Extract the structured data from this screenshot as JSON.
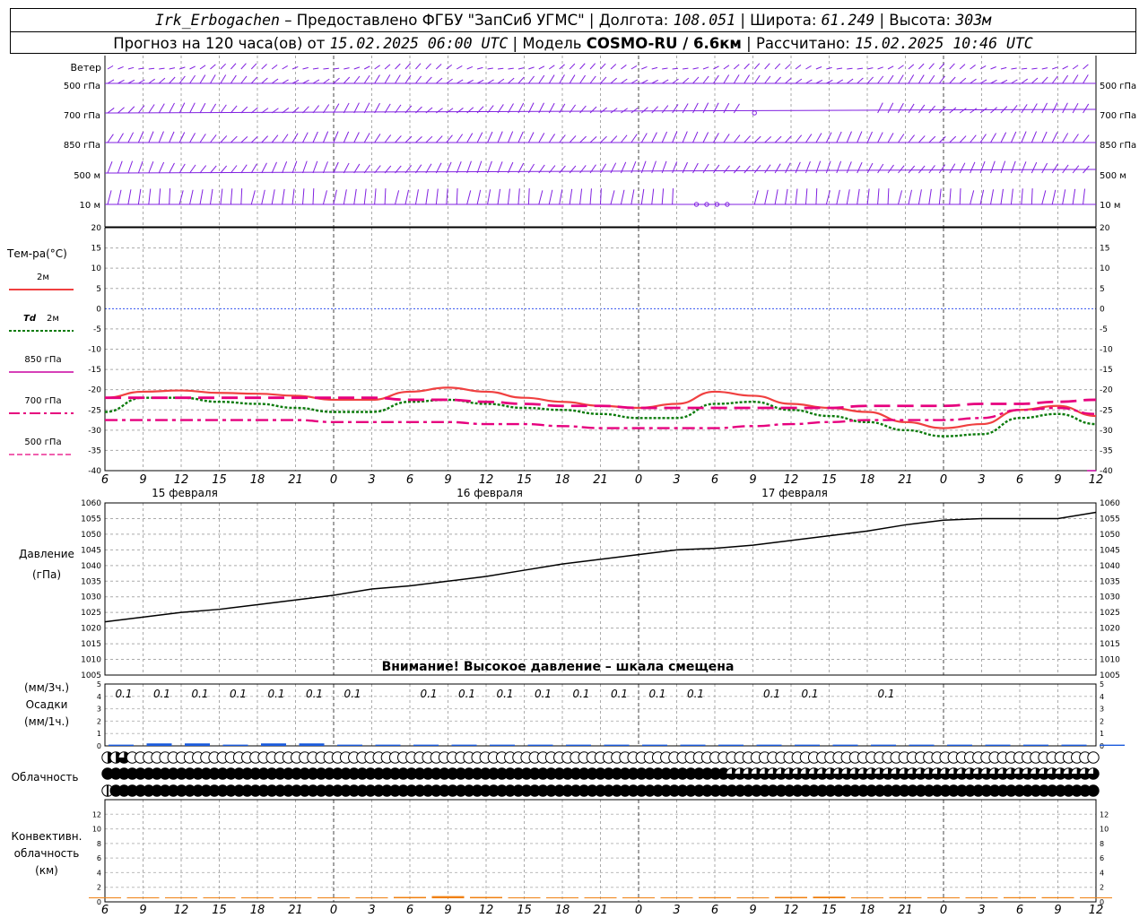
{
  "header": {
    "station": "Irk_Erbogachen",
    "provider": " – Предоставлено ФГБУ \"ЗапСиб УГМС\" | Долгота: ",
    "lon": "108.051",
    "lat_label": " | Широта: ",
    "lat": "61.249",
    "alt_label": " | Высота: ",
    "alt": "303м",
    "forecast_label": "Прогноз на 120 часа(ов) от ",
    "forecast_time": "15.02.2025 06:00 UTC",
    "model_label": "  | Модель ",
    "model": "COSMO-RU / 6.6км",
    "calc_label": " | Рассчитано: ",
    "calc_time": "15.02.2025 10:46 UTC"
  },
  "labels": {
    "wind": "Ветер",
    "levels": [
      "500 гПа",
      "700 гПа",
      "850 гПа",
      "500 м",
      "10  м"
    ],
    "temp_title": "Тем-ра(°C)",
    "t2m": "2м",
    "td_a": "Td",
    "td_b": "2м",
    "t850": "850 гПа",
    "t700": "700 гПа",
    "t500": "500 гПа",
    "pressure_a": "Давление",
    "pressure_b": "(гПа)",
    "warning": "Внимание! Высокое давление – шкала смещена",
    "precip_a": "(мм/3ч.)",
    "precip_b": "Осадки",
    "precip_c": "(мм/1ч.)",
    "cloud": "Облачность",
    "conv_a": "Конвективн.",
    "conv_b": "облачность",
    "conv_c": "(км)",
    "days": [
      "15 февраля",
      "16 февраля",
      "17 февраля"
    ],
    "precip_amount": "0.1"
  },
  "colors": {
    "t2m": "#f04040",
    "td": "#0a7a0a",
    "t850": "#c800a0",
    "t700": "#e6007e",
    "t500": "#e6007e",
    "wind": "#8020e0",
    "precip": "#1a5adc",
    "conv": "#f08010",
    "zero": "#3050f0"
  },
  "chart_data": [
    {
      "type": "line",
      "title": "Тем-ра(°C)",
      "x_ticks": [
        "6",
        "9",
        "12",
        "15",
        "18",
        "21",
        "0",
        "3",
        "6",
        "9",
        "12",
        "15",
        "18",
        "21",
        "0",
        "3",
        "6",
        "9",
        "12",
        "15",
        "18",
        "21",
        "0",
        "3",
        "6",
        "9",
        "12"
      ],
      "ylim": [
        -40,
        20
      ],
      "y_ticks": [
        20,
        15,
        10,
        5,
        0,
        -5,
        -10,
        -15,
        -20,
        -25,
        -30,
        -35,
        -40
      ],
      "series": [
        {
          "name": "2м",
          "style": "solid",
          "values": [
            -22,
            -20.5,
            -20.2,
            -20.8,
            -21,
            -21.5,
            -22.5,
            -22.5,
            -20.5,
            -19.5,
            -20.5,
            -22,
            -23,
            -24,
            -24.5,
            -23.5,
            -20.5,
            -21.5,
            -23.5,
            -24.5,
            -25.5,
            -28,
            -29.5,
            -28.5,
            -25,
            -24,
            -26.5
          ]
        },
        {
          "name": "Td 2м",
          "style": "dotted",
          "values": [
            -25.5,
            -22,
            -22,
            -23,
            -23.5,
            -24.5,
            -25.5,
            -25.5,
            -23,
            -22.5,
            -23.5,
            -24.5,
            -25,
            -26,
            -27,
            -27,
            -23.5,
            -23,
            -25,
            -26.5,
            -28,
            -30,
            -31.5,
            -31,
            -27,
            -26,
            -28.5
          ]
        },
        {
          "name": "850 гПа",
          "style": "solid",
          "values": [
            null,
            null,
            null,
            null,
            null,
            null,
            null,
            null,
            null,
            null,
            null,
            null,
            null,
            null,
            null,
            null,
            null,
            null,
            null,
            null,
            null,
            null,
            null,
            null,
            null,
            null,
            -40
          ]
        },
        {
          "name": "700 гПа",
          "style": "dashdot",
          "values": [
            -27.5,
            -27.5,
            -27.5,
            -27.5,
            -27.5,
            -27.5,
            -28,
            -28,
            -28,
            -28,
            -28.5,
            -28.5,
            -29,
            -29.5,
            -29.5,
            -29.5,
            -29.5,
            -29,
            -28.5,
            -28,
            -27.5,
            -27.5,
            -27.5,
            -27,
            -25,
            -24.5,
            -26
          ]
        },
        {
          "name": "500 гПа",
          "style": "dashed",
          "values": [
            -22,
            -22,
            -22,
            -22,
            -22,
            -22,
            -22,
            -22,
            -22.5,
            -22.5,
            -23,
            -23.5,
            -24,
            -24,
            -24.5,
            -24.5,
            -24.5,
            -24.5,
            -24.5,
            -24.5,
            -24,
            -24,
            -24,
            -23.5,
            -23.5,
            -23,
            -22.5
          ]
        }
      ]
    },
    {
      "type": "line",
      "title": "Давление (гПа)",
      "ylim": [
        1005,
        1060
      ],
      "y_ticks": [
        1060,
        1055,
        1050,
        1045,
        1040,
        1035,
        1030,
        1025,
        1020,
        1015,
        1010,
        1005
      ],
      "series": [
        {
          "name": "Давление",
          "values": [
            1022,
            1023.5,
            1025,
            1026,
            1027.5,
            1029,
            1030.5,
            1032.5,
            1033.5,
            1035,
            1036.5,
            1038.5,
            1040.5,
            1042,
            1043.5,
            1045,
            1045.5,
            1046.5,
            1048,
            1049.5,
            1051,
            1053,
            1054.5,
            1055,
            1055,
            1055,
            1057
          ]
        }
      ]
    },
    {
      "type": "bar",
      "title": "Осадки (мм/3ч.)",
      "ylim": [
        0,
        5
      ],
      "y_ticks": [
        5,
        4,
        3,
        2,
        1,
        0
      ],
      "values": [
        0.1,
        0.1,
        0.1,
        0.1,
        0.1,
        0.1,
        0.1,
        null,
        0.1,
        0.1,
        0.1,
        0.1,
        0.1,
        0.1,
        0.1,
        0.1,
        null,
        0.1,
        0.1,
        null,
        0.1,
        null,
        null,
        null,
        null,
        null,
        null
      ],
      "hourly_bars": [
        0.05,
        0.1,
        0.1,
        0.05,
        0.1,
        0.1,
        0.05,
        0.05,
        0.05,
        0.05,
        0.05,
        0.05,
        0.05,
        0.05,
        0.05,
        0.05,
        0.05,
        0.05,
        0.05,
        0.05,
        0.05,
        0.05,
        0.05,
        0.05,
        0.05,
        0.05,
        0.05
      ]
    },
    {
      "type": "table",
      "title": "Облачность",
      "rows": [
        [
          2,
          2,
          3,
          0,
          0,
          0,
          0,
          0,
          0,
          0,
          0,
          0,
          0,
          0,
          0,
          0,
          0,
          0,
          0,
          0,
          0,
          0,
          0,
          0,
          0,
          0,
          0,
          0,
          0,
          0,
          0,
          0,
          0,
          0,
          0,
          0,
          0,
          0,
          0,
          0,
          0,
          0,
          0,
          0,
          0,
          0,
          0,
          0,
          0,
          0,
          0,
          0,
          0,
          0,
          0,
          0,
          0,
          0,
          0,
          0,
          0,
          0,
          0,
          0,
          0,
          0,
          0,
          0,
          0,
          0,
          0,
          0,
          0,
          0,
          0,
          0,
          0,
          0,
          0,
          0,
          0,
          0,
          0,
          0,
          0,
          0,
          0,
          0,
          0,
          0,
          0,
          0,
          0,
          0,
          0,
          0,
          0,
          0,
          0,
          0,
          0,
          0,
          0,
          0,
          0,
          0,
          0,
          0,
          0,
          0,
          0,
          0,
          0,
          0,
          0,
          0,
          0,
          0,
          0,
          0,
          0
        ],
        [
          4,
          4,
          4,
          4,
          4,
          4,
          4,
          4,
          4,
          4,
          4,
          4,
          4,
          4,
          4,
          4,
          4,
          4,
          4,
          4,
          4,
          4,
          4,
          4,
          4,
          4,
          4,
          4,
          4,
          4,
          4,
          4,
          4,
          4,
          4,
          4,
          4,
          4,
          4,
          4,
          4,
          4,
          4,
          4,
          4,
          4,
          4,
          4,
          4,
          4,
          4,
          4,
          4,
          4,
          4,
          4,
          4,
          4,
          4,
          4,
          4,
          4,
          4,
          4,
          4,
          4,
          4,
          4,
          4,
          4,
          4,
          4,
          4,
          4,
          4,
          4,
          3,
          3,
          3,
          3,
          3,
          3,
          3,
          3,
          3,
          3,
          3,
          3,
          3,
          3,
          3,
          3,
          3,
          3,
          3,
          3,
          3,
          3,
          3,
          3,
          3,
          3,
          3,
          3,
          3,
          3,
          3,
          3,
          3,
          3,
          3,
          3,
          3,
          3,
          3,
          3,
          3,
          3,
          3,
          3,
          3
        ],
        [
          1,
          4,
          4,
          4,
          4,
          4,
          4,
          4,
          4,
          4,
          4,
          4,
          4,
          4,
          4,
          4,
          4,
          4,
          4,
          4,
          4,
          4,
          4,
          4,
          4,
          4,
          4,
          4,
          4,
          4,
          4,
          4,
          4,
          4,
          4,
          4,
          4,
          4,
          4,
          4,
          4,
          4,
          4,
          4,
          4,
          4,
          4,
          4,
          4,
          4,
          4,
          4,
          4,
          4,
          4,
          4,
          4,
          4,
          4,
          4,
          4,
          4,
          4,
          4,
          4,
          4,
          4,
          4,
          4,
          4,
          4,
          4,
          4,
          4,
          4,
          4,
          4,
          4,
          4,
          4,
          4,
          4,
          4,
          4,
          4,
          4,
          4,
          4,
          4,
          4,
          4,
          4,
          4,
          4,
          4,
          4,
          4,
          4,
          4,
          4,
          4,
          4,
          4,
          4,
          4,
          4,
          4,
          4,
          4,
          4,
          4,
          4,
          4,
          4,
          4,
          4,
          4,
          4,
          4,
          4,
          4
        ]
      ],
      "legend": "0 = clear, 1 = 1/4, 2 = 1/2, 3 = 3/4, 4 = overcast"
    },
    {
      "type": "area",
      "title": "Конвективн. облачность (км)",
      "ylim": [
        0,
        14
      ],
      "y_ticks": [
        12,
        10,
        8,
        6,
        4,
        2,
        0
      ],
      "values": [
        0.6,
        0.6,
        0.5,
        0.4,
        0.4,
        0.5,
        0.5,
        0.6,
        0.8,
        1.1,
        0.8,
        0.5,
        0.5,
        0.5,
        0.5,
        0.5,
        0.7,
        0.5,
        0.8,
        0.9,
        0.6,
        0.7,
        0.6,
        0.6,
        0.7,
        0.7,
        0.5
      ]
    }
  ]
}
